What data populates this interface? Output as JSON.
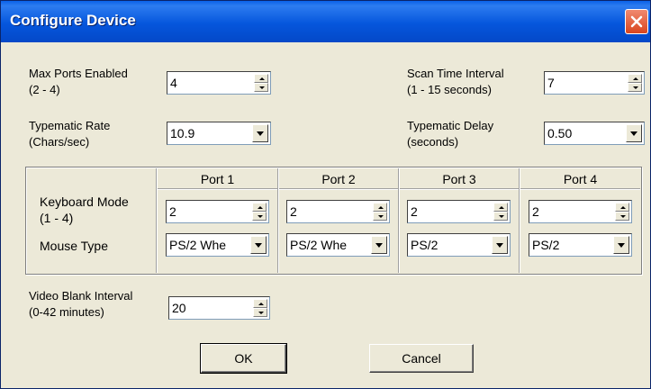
{
  "window": {
    "title": "Configure Device"
  },
  "max_ports": {
    "label_line1": "Max Ports Enabled",
    "label_line2": "(2 - 4)",
    "value": "4"
  },
  "scan_time": {
    "label_line1": "Scan Time Interval",
    "label_line2": "(1 - 15 seconds)",
    "value": "7"
  },
  "typematic_rate": {
    "label_line1": "Typematic Rate",
    "label_line2": "(Chars/sec)",
    "value": "10.9"
  },
  "typematic_delay": {
    "label_line1": "Typematic Delay",
    "label_line2": "(seconds)",
    "value": "0.50"
  },
  "ports_table": {
    "row_labels": {
      "keyboard_mode_line1": "Keyboard Mode",
      "keyboard_mode_line2": "(1 - 4)",
      "mouse_type": "Mouse Type"
    },
    "ports": [
      {
        "name": "Port 1",
        "keyboard_mode": "2",
        "mouse_type": "PS/2 Whe"
      },
      {
        "name": "Port 2",
        "keyboard_mode": "2",
        "mouse_type": "PS/2 Whe"
      },
      {
        "name": "Port 3",
        "keyboard_mode": "2",
        "mouse_type": "PS/2"
      },
      {
        "name": "Port 4",
        "keyboard_mode": "2",
        "mouse_type": "PS/2"
      }
    ]
  },
  "video_blank": {
    "label_line1": "Video Blank Interval",
    "label_line2": "(0-42 minutes)",
    "value": "20"
  },
  "buttons": {
    "ok": "OK",
    "cancel": "Cancel"
  },
  "colors": {
    "titlebar": "#0556DC",
    "dialog_bg": "#ECE9D8",
    "close_button": "#D9451E"
  },
  "icons": {
    "close": "close-icon",
    "spin_up": "spin-up-arrow-icon",
    "spin_down": "spin-down-arrow-icon",
    "dropdown": "dropdown-arrow-icon"
  }
}
